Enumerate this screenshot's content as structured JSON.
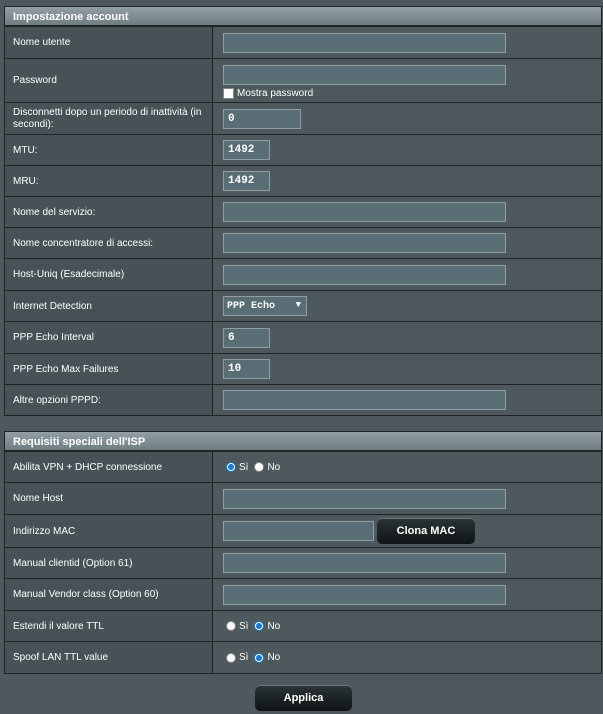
{
  "account": {
    "title": "Impostazione account",
    "username_label": "Nome utente",
    "username_value": "",
    "password_label": "Password",
    "password_value": "",
    "show_password_label": "Mostra password",
    "idle_label": "Disconnetti dopo un periodo di inattività (in secondi):",
    "idle_value": "0",
    "mtu_label": "MTU:",
    "mtu_value": "1492",
    "mru_label": "MRU:",
    "mru_value": "1492",
    "service_label": "Nome del servizio:",
    "service_value": "",
    "ac_label": "Nome concentratore di accessi:",
    "ac_value": "",
    "hostuniq_label": "Host-Uniq (Esadecimale)",
    "hostuniq_value": "",
    "detection_label": "Internet Detection",
    "detection_value": "PPP Echo",
    "echo_interval_label": "PPP Echo Interval",
    "echo_interval_value": "6",
    "echo_failures_label": "PPP Echo Max Failures",
    "echo_failures_value": "10",
    "pppd_label": "Altre opzioni PPPD:",
    "pppd_value": ""
  },
  "isp": {
    "title": "Requisiti speciali dell'ISP",
    "vpn_label": "Abilita VPN + DHCP connessione",
    "vpn_yes": "Sì",
    "vpn_no": "No",
    "vpn_selected": "yes",
    "hostname_label": "Nome Host",
    "hostname_value": "",
    "mac_label": "Indirizzo MAC",
    "mac_value": "",
    "clone_mac_label": "Clona MAC",
    "clientid_label": "Manual clientid (Option 61)",
    "clientid_value": "",
    "vendor_label": "Manual Vendor class (Option 60)",
    "vendor_value": "",
    "ttl_label": "Estendi il valore TTL",
    "ttl_yes": "Sì",
    "ttl_no": "No",
    "ttl_selected": "no",
    "spoof_label": "Spoof LAN TTL value",
    "spoof_yes": "Sì",
    "spoof_no": "No",
    "spoof_selected": "no"
  },
  "apply_label": "Applica"
}
